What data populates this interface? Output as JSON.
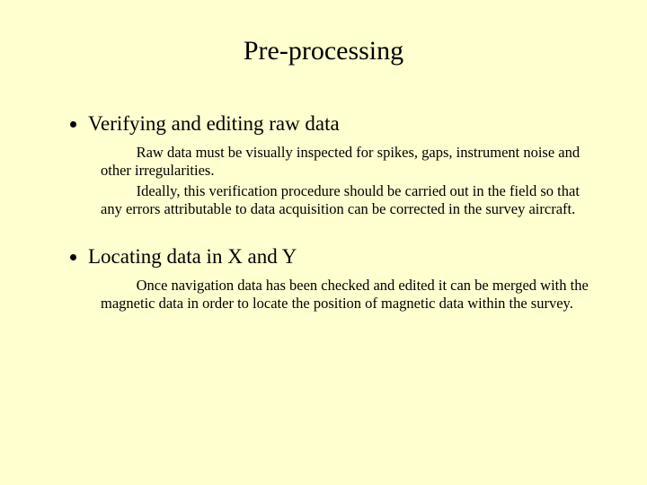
{
  "title": "Pre-processing",
  "bullets": [
    {
      "heading": "Verifying and editing raw data",
      "paragraphs": [
        "Raw data must be visually inspected for spikes, gaps, instrument noise and other irregularities.",
        "Ideally, this verification procedure should be carried out in the field so that any errors attributable to data acquisition can be corrected in the survey aircraft."
      ]
    },
    {
      "heading": "Locating data in X and Y",
      "paragraphs": [
        "Once navigation data has been checked and edited it can be merged with the magnetic data in order to locate the position of magnetic data within the survey."
      ]
    }
  ]
}
